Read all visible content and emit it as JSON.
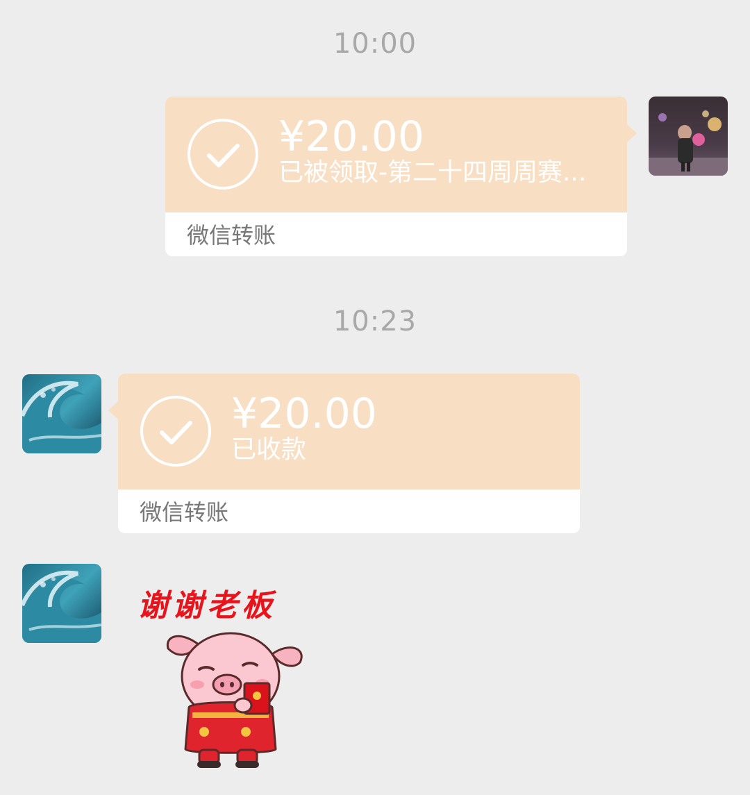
{
  "chat": {
    "timestamp_1": "10:00",
    "timestamp_2": "10:23",
    "message_1": {
      "amount": "¥20.00",
      "status": "已被领取-第二十四周周赛...",
      "footer": "微信转账",
      "icon": "check-circle-icon"
    },
    "message_2": {
      "amount": "¥20.00",
      "status": "已收款",
      "footer": "微信转账",
      "icon": "check-circle-icon"
    },
    "message_3": {
      "sticker_text": "谢谢老板",
      "sticker_image": "pig-holding-red-envelope"
    }
  },
  "colors": {
    "background": "#ededed",
    "card_top": "#f8dfc4",
    "card_bottom": "#ffffff",
    "timestamp": "#a8a8a8",
    "sticker_text": "#e8141c"
  }
}
